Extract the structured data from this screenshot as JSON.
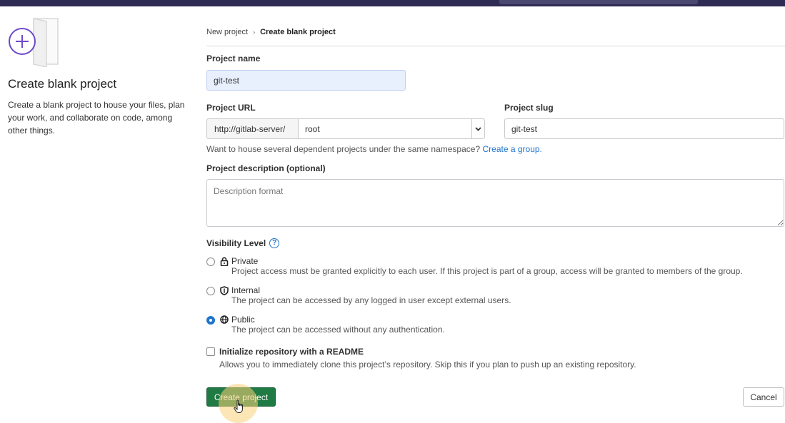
{
  "sidebar": {
    "title": "Create blank project",
    "description": "Create a blank project to house your files, plan your work, and collaborate on code, among other things.",
    "illustration_icon": "plus-circle-icon"
  },
  "breadcrumb": {
    "parent": "New project",
    "current": "Create blank project"
  },
  "form": {
    "project_name": {
      "label": "Project name",
      "value": "git-test"
    },
    "project_url": {
      "label": "Project URL",
      "prefix": "http://gitlab-server/",
      "namespace": "root"
    },
    "project_slug": {
      "label": "Project slug",
      "value": "git-test"
    },
    "namespace_help": {
      "text": "Want to house several dependent projects under the same namespace?",
      "link": "Create a group."
    },
    "description": {
      "label": "Project description (optional)",
      "placeholder": "Description format"
    },
    "visibility": {
      "label": "Visibility Level",
      "options": [
        {
          "title": "Private",
          "icon": "lock-icon",
          "description": "Project access must be granted explicitly to each user. If this project is part of a group, access will be granted to members of the group.",
          "checked": false
        },
        {
          "title": "Internal",
          "icon": "shield-icon",
          "description": "The project can be accessed by any logged in user except external users.",
          "checked": false
        },
        {
          "title": "Public",
          "icon": "globe-icon",
          "description": "The project can be accessed without any authentication.",
          "checked": true
        }
      ]
    },
    "readme": {
      "label": "Initialize repository with a README",
      "description": "Allows you to immediately clone this project’s repository. Skip this if you plan to push up an existing repository.",
      "checked": false
    }
  },
  "actions": {
    "create": "Create project",
    "cancel": "Cancel"
  },
  "colors": {
    "brand_purple": "#6e49cb",
    "primary_green": "#1f7a43",
    "link_blue": "#1f75cb",
    "topbar": "#2e2b54"
  }
}
